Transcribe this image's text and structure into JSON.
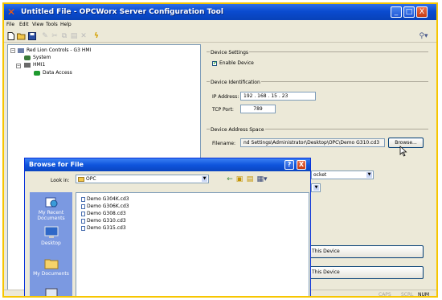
{
  "window": {
    "title": "Untitled File - OPCWorx Server Configuration Tool",
    "menu": [
      "File",
      "Edit",
      "View",
      "Tools",
      "Help"
    ],
    "minimize": "_",
    "maximize": "□",
    "close": "X"
  },
  "tree": {
    "root": "Red Lion Controls - G3 HMI",
    "system": "System",
    "hmi": "HMI1",
    "data_access": "Data Access"
  },
  "device_settings": {
    "group_label": "Device Settings",
    "enable_label": "Enable Device",
    "enabled": true
  },
  "device_identification": {
    "group_label": "Device Identification",
    "ip_label": "IP Address:",
    "ip_value": "192 . 168 . 15 . 23",
    "tcp_label": "TCP Port:",
    "tcp_value": "789"
  },
  "device_address_space": {
    "group_label": "Device Address Space",
    "filename_label": "Filename:",
    "filename_value": "nd Settings\\Administrator\\Desktop\\OPC\\Demo G310.cd3",
    "browse_label": "Browse..."
  },
  "partial": {
    "protocol_value": "ocket",
    "add_device": "This Device",
    "delete_device": "This Device"
  },
  "status": {
    "caps": "CAPS",
    "num": "NUM"
  },
  "dialog": {
    "title": "Browse for File",
    "help": "?",
    "close": "X",
    "look_in_label": "Look in:",
    "look_in_value": "OPC",
    "places": [
      "My Recent Documents",
      "Desktop",
      "My Documents"
    ],
    "files": [
      "Demo G304K.cd3",
      "Demo G306K.cd3",
      "Demo G308.cd3",
      "Demo G310.cd3",
      "Demo G315.cd3"
    ]
  },
  "colors": {
    "accent_frame": "#f7c600",
    "titlebar": "#0a4bd0",
    "places_bar": "#7b99e1"
  }
}
